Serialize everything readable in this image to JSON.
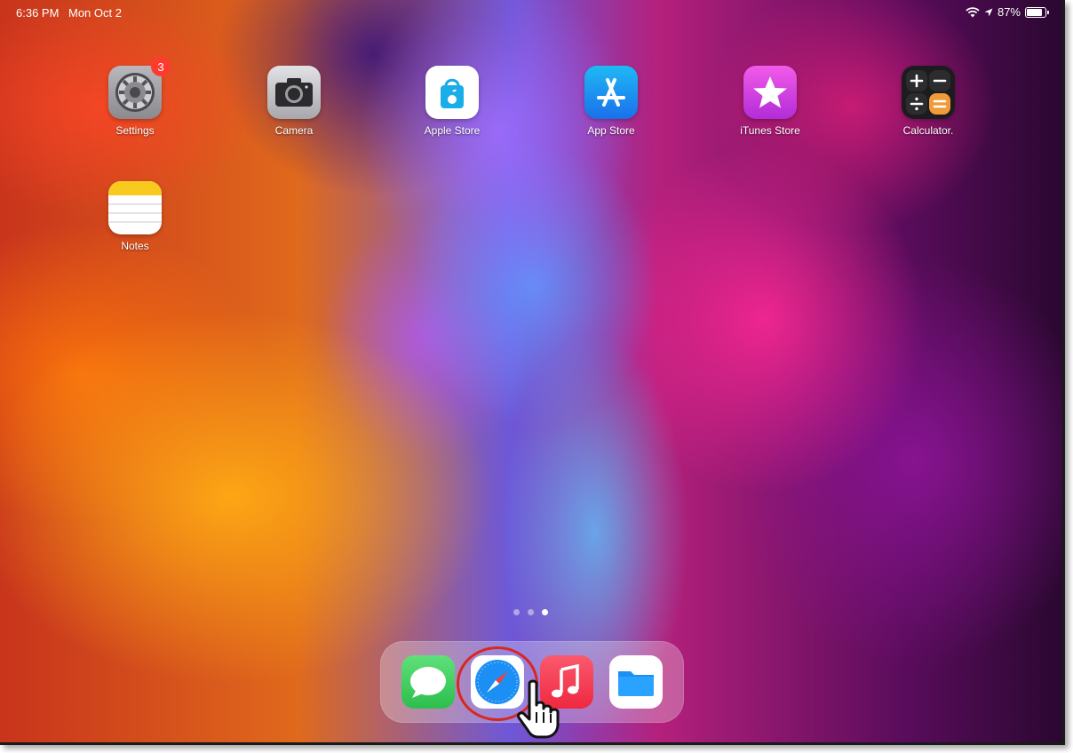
{
  "status_bar": {
    "time": "6:36 PM",
    "date": "Mon Oct 2",
    "battery": "87%",
    "icons": [
      "wifi-icon",
      "location-icon",
      "battery-icon"
    ]
  },
  "apps": [
    {
      "id": "settings",
      "label": "Settings",
      "icon": "gear-icon",
      "badge": "3"
    },
    {
      "id": "camera",
      "label": "Camera",
      "icon": "camera-icon"
    },
    {
      "id": "apple-store",
      "label": "Apple Store",
      "icon": "shopping-bag-icon"
    },
    {
      "id": "app-store",
      "label": "App Store",
      "icon": "app-store-icon"
    },
    {
      "id": "itunes-store",
      "label": "iTunes Store",
      "icon": "star-icon"
    },
    {
      "id": "calculator",
      "label": "Calculator.",
      "icon": "calculator-icon"
    },
    {
      "id": "notes",
      "label": "Notes",
      "icon": "notes-icon"
    }
  ],
  "page_indicator": {
    "count": 3,
    "active_index": 2
  },
  "dock": [
    {
      "id": "messages",
      "icon": "speech-bubble-icon"
    },
    {
      "id": "safari",
      "icon": "compass-icon",
      "highlighted": true
    },
    {
      "id": "music",
      "icon": "music-note-icon"
    },
    {
      "id": "files",
      "icon": "folder-icon"
    }
  ],
  "colors": {
    "badge": "#ff3b30",
    "highlight_ring": "#d8281e",
    "app_store_blue": "#1a8cf0",
    "itunes_pink": "#d83adc",
    "messages_green": "#38c95a",
    "music_red": "#f5374d"
  }
}
